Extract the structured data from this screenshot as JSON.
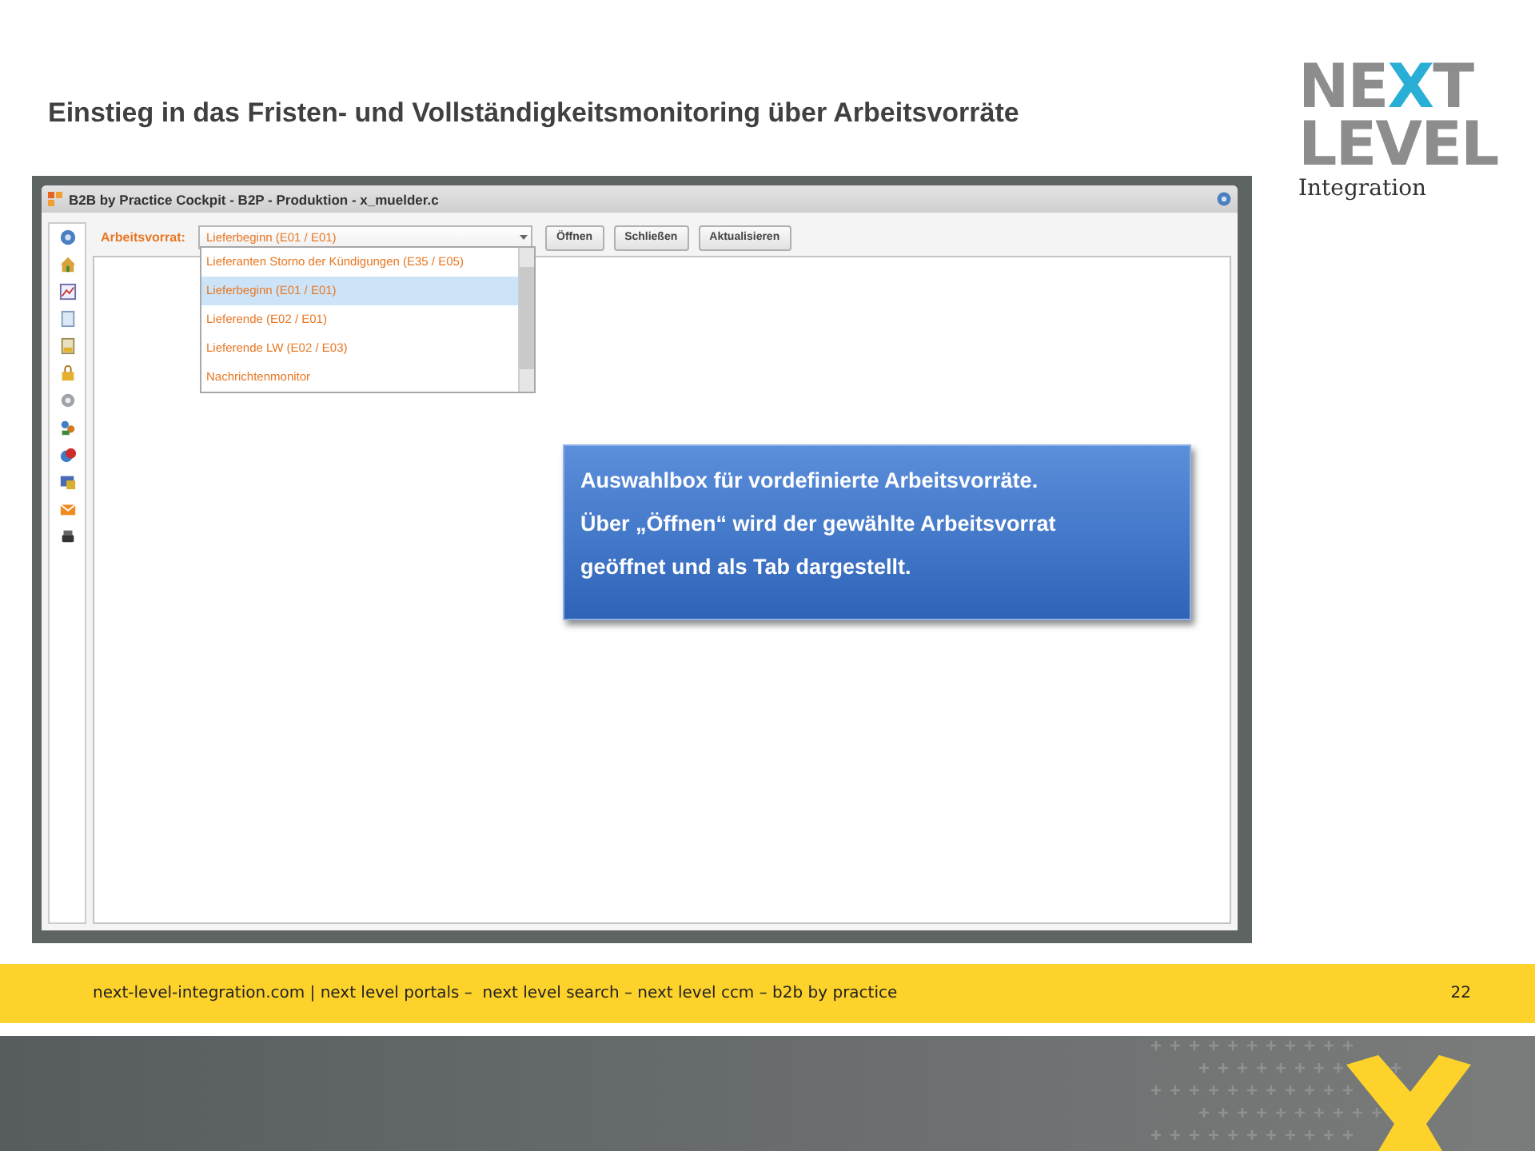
{
  "slide": {
    "title": "Einstieg in das Fristen- und Vollständigkeitsmonitoring über Arbeitsvorräte",
    "logo": {
      "line1_left": "NE",
      "line1_accent": "X",
      "line1_right": "T",
      "line2": "LEVEL",
      "line3": "Integration"
    }
  },
  "app": {
    "window_title": "B2B by Practice Cockpit - B2P - Produktion - x_muelder.c",
    "toolbar": {
      "label": "Arbeitsvorrat:",
      "combo_value": "Lieferbeginn (E01 / E01)",
      "buttons": [
        "Öffnen",
        "Schließen",
        "Aktualisieren"
      ]
    },
    "dropdown": {
      "items": [
        {
          "label": "Lieferanten Storno der Kündigungen (E35 / E05)",
          "selected": false
        },
        {
          "label": "Lieferbeginn (E01 / E01)",
          "selected": true
        },
        {
          "label": "Lieferende (E02 / E01)",
          "selected": false
        },
        {
          "label": "Lieferende LW (E02 / E03)",
          "selected": false
        },
        {
          "label": "Nachrichtenmonitor",
          "selected": false
        }
      ]
    }
  },
  "callout": {
    "lines": [
      "Auswahlbox für vordefinierte Arbeitsvorräte.",
      "Über „Öffnen“ wird der gewählte Arbeitsvorrat",
      "geöffnet und als Tab dargestellt."
    ]
  },
  "footer": {
    "text": "next-level-integration.com | next level portals –  next level search – next level ccm – b2b by practice",
    "page": "22"
  }
}
